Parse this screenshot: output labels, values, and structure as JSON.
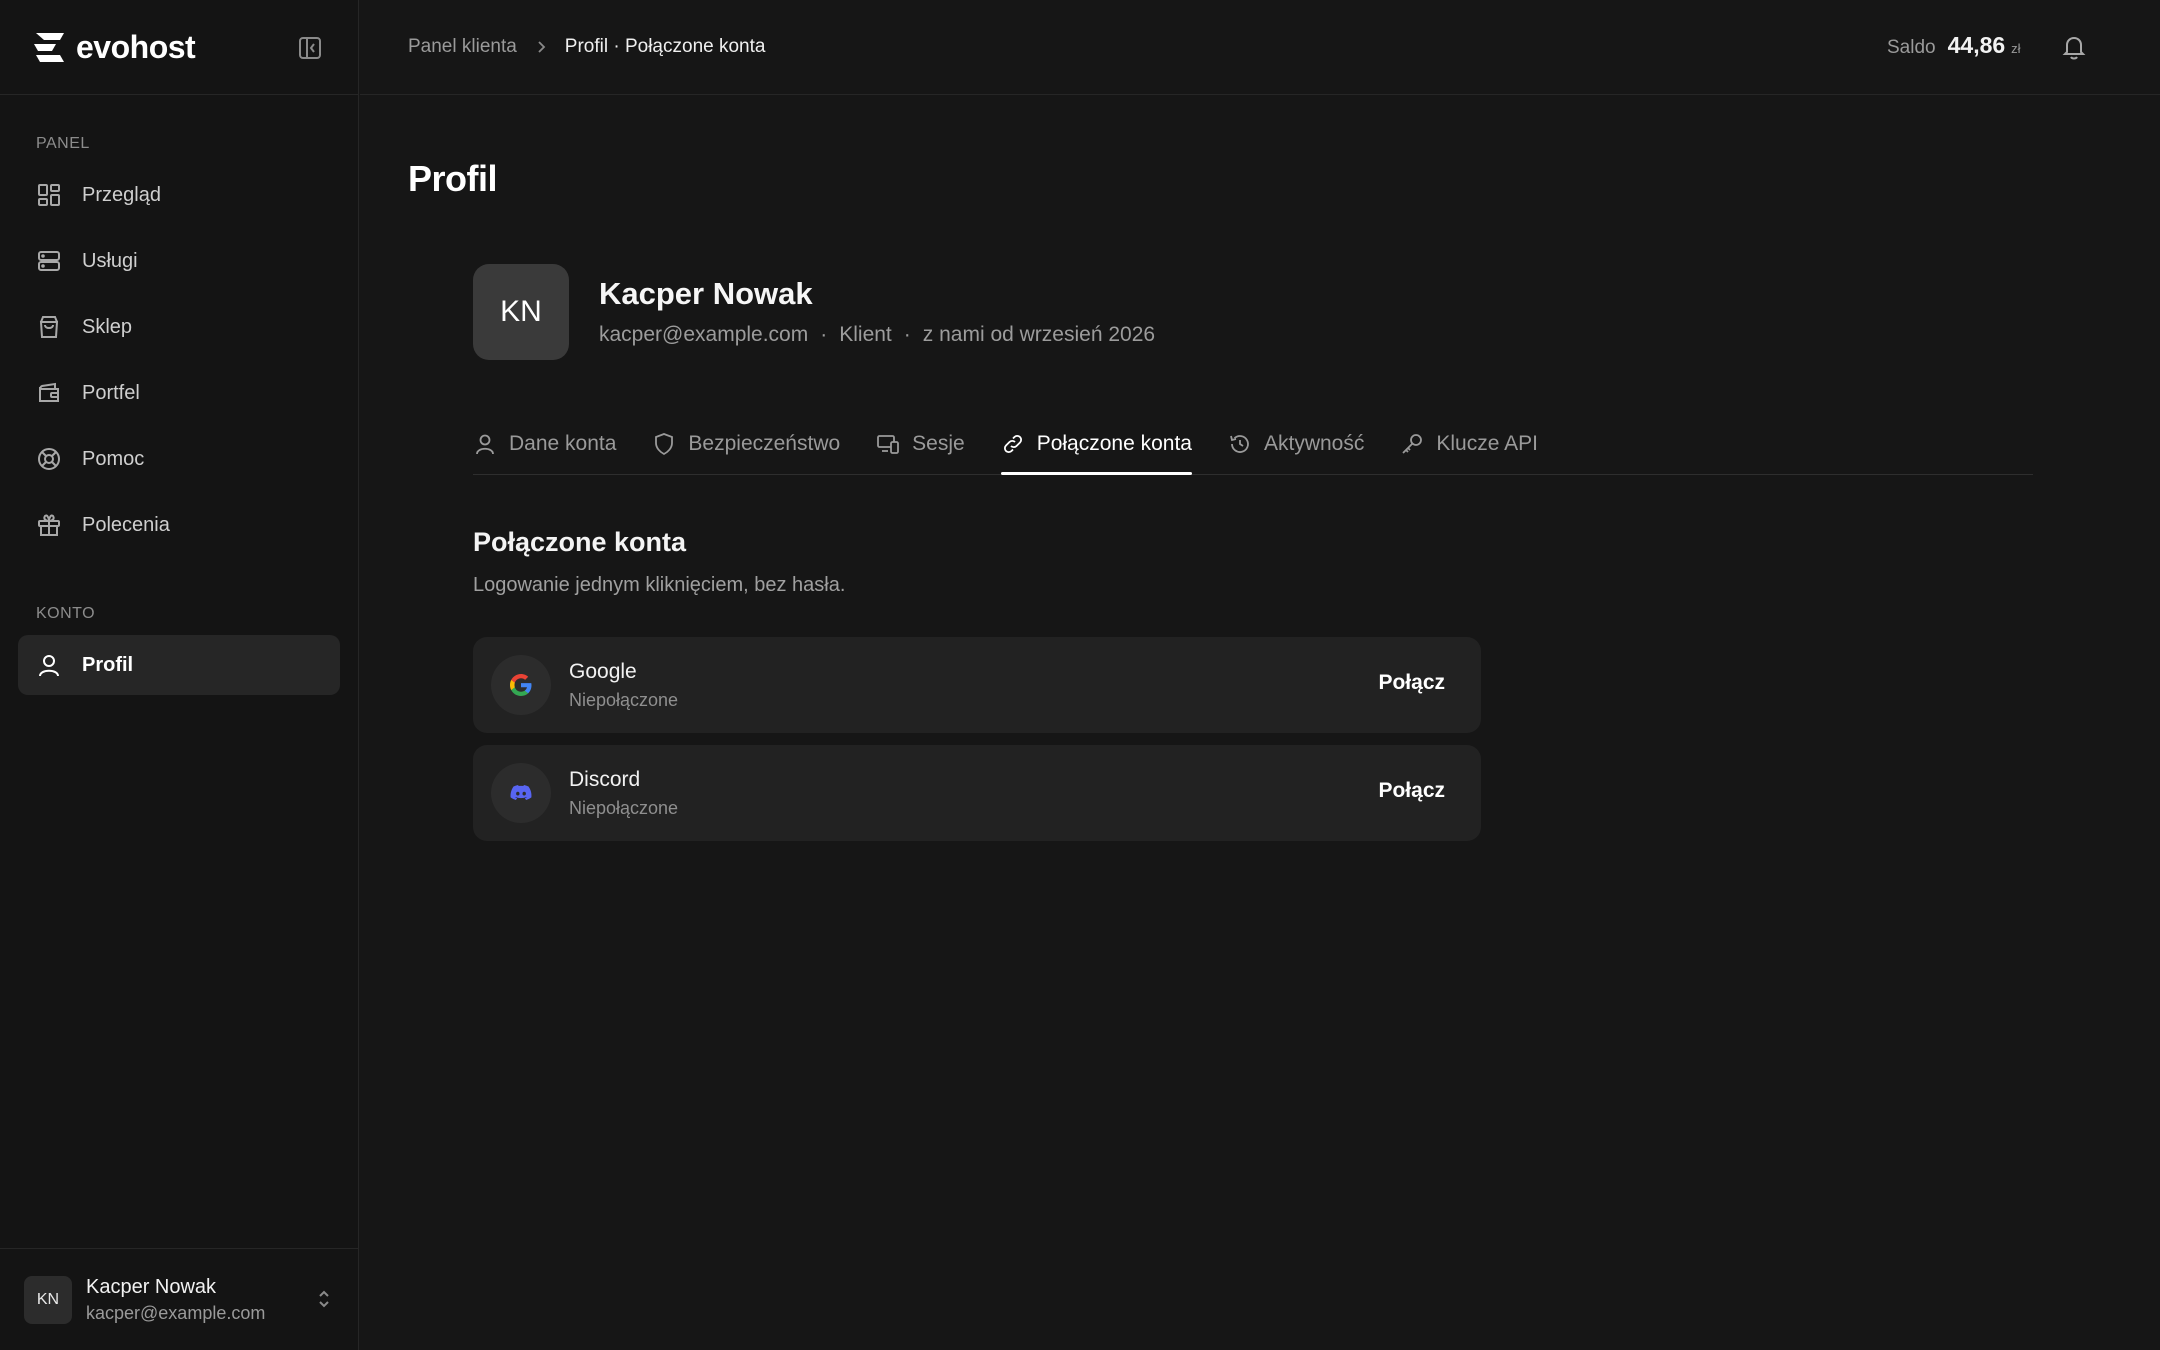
{
  "brand": {
    "name": "evohost"
  },
  "sidebar": {
    "panel_label": "PANEL",
    "panel_items": [
      {
        "label": "Przegląd",
        "icon": "dashboard-icon"
      },
      {
        "label": "Usługi",
        "icon": "server-icon"
      },
      {
        "label": "Sklep",
        "icon": "shopping-bag-icon"
      },
      {
        "label": "Portfel",
        "icon": "wallet-icon"
      },
      {
        "label": "Pomoc",
        "icon": "lifebuoy-icon"
      },
      {
        "label": "Polecenia",
        "icon": "gift-icon"
      }
    ],
    "konto_label": "KONTO",
    "konto_items": [
      {
        "label": "Profil",
        "icon": "user-icon",
        "active": true
      }
    ]
  },
  "user": {
    "initials": "KN",
    "name": "Kacper Nowak",
    "email": "kacper@example.com"
  },
  "header": {
    "breadcrumb_root": "Panel klienta",
    "breadcrumb_current": "Profil · Połączone konta",
    "saldo_label": "Saldo",
    "saldo_value": "44,86",
    "saldo_unit": "zł"
  },
  "page": {
    "title": "Profil"
  },
  "profile": {
    "initials": "KN",
    "name": "Kacper Nowak",
    "email": "kacper@example.com",
    "role": "Klient",
    "since": "z nami od wrzesień 2026",
    "separator": "·"
  },
  "tabs": [
    {
      "label": "Dane konta",
      "icon": "user-icon"
    },
    {
      "label": "Bezpieczeństwo",
      "icon": "shield-icon"
    },
    {
      "label": "Sesje",
      "icon": "devices-icon"
    },
    {
      "label": "Połączone konta",
      "icon": "link-icon",
      "active": true
    },
    {
      "label": "Aktywność",
      "icon": "history-icon"
    },
    {
      "label": "Klucze API",
      "icon": "key-icon"
    }
  ],
  "connected": {
    "title": "Połączone konta",
    "subtitle": "Logowanie jednym kliknięciem, bez hasła.",
    "accounts": [
      {
        "name": "Google",
        "status": "Niepołączone",
        "action": "Połącz",
        "icon": "google-icon"
      },
      {
        "name": "Discord",
        "status": "Niepołączone",
        "action": "Połącz",
        "icon": "discord-icon",
        "color": "#5865F2"
      }
    ]
  }
}
